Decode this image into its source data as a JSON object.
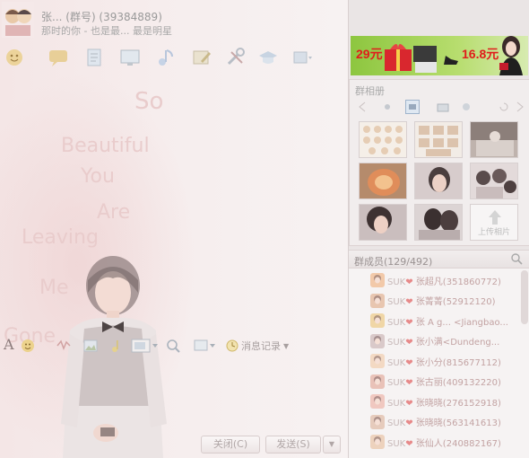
{
  "window": {
    "group_name": "张... (群号) (39384889)",
    "group_signature": "那时的你 - 也是最... 最是明星"
  },
  "toolbar": {
    "icons": [
      "emoticon-icon",
      "chat-bubble-icon",
      "document-icon",
      "screen-icon",
      "music-icon",
      "edit-icon",
      "tools-icon",
      "hat-icon",
      "more-icon"
    ]
  },
  "wallpaper": {
    "words": [
      "So",
      "Beautiful",
      "You",
      "Are",
      "Leaving",
      "Me",
      "Gone"
    ]
  },
  "input_toolbar": {
    "history_label": "消息记录"
  },
  "buttons": {
    "close": "关闭(C)",
    "send": "发送(S)",
    "send_arrow": "▼"
  },
  "ad": {
    "price_left": "29元",
    "price_right": "16.8元"
  },
  "album": {
    "title": "群相册",
    "upload_label": "上传相片"
  },
  "members": {
    "title": "群成员(129/492)",
    "list": [
      {
        "tag": "SUK",
        "heart": "❤",
        "name": "张超凡(351860772)"
      },
      {
        "tag": "SUK",
        "heart": "❤",
        "name": "张菁菁(52912120)"
      },
      {
        "tag": "SUK",
        "heart": "❤",
        "name": "张 A g... <Jiangbao..."
      },
      {
        "tag": "SUK",
        "heart": "❤",
        "name": "张小满<Dundeng..."
      },
      {
        "tag": "SUK",
        "heart": "❤",
        "name": "张小分(815677112)"
      },
      {
        "tag": "SUK",
        "heart": "❤",
        "name": "张古丽(409132220)"
      },
      {
        "tag": "SUK",
        "heart": "❤",
        "name": "张晓晓(276152918)"
      },
      {
        "tag": "SUK",
        "heart": "❤",
        "name": "张晓晓(563141613)"
      },
      {
        "tag": "SUK",
        "heart": "❤",
        "name": "张仙人(240882167)"
      }
    ]
  }
}
